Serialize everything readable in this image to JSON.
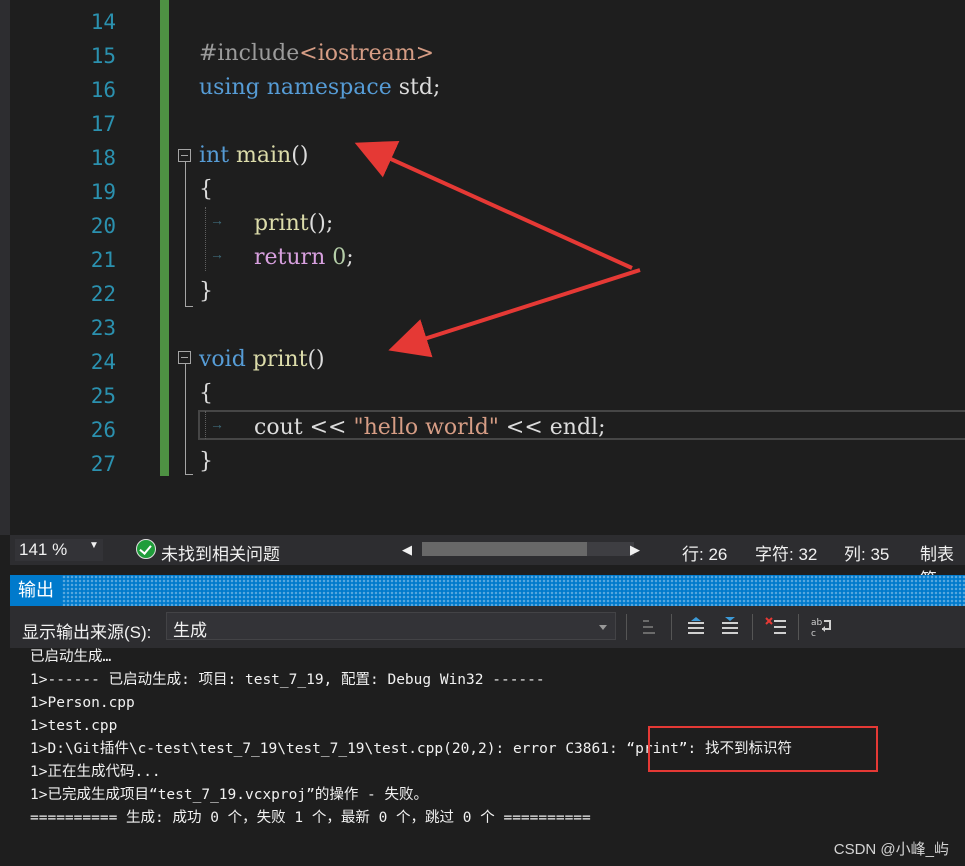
{
  "editor": {
    "line_numbers": [
      "14",
      "15",
      "16",
      "17",
      "18",
      "19",
      "20",
      "21",
      "22",
      "23",
      "24",
      "25",
      "26",
      "27"
    ],
    "lines": {
      "l15_pre": "#include",
      "l15_inc": "<iostream>",
      "l16_kw1": "using",
      "l16_kw2": "namespace",
      "l16_ns": "std",
      "l16_end": ";",
      "l18_kw": "int",
      "l18_fn": "main",
      "l18_end": "()",
      "l19": "{",
      "l20_fn": "print",
      "l20_end": "();",
      "l21_ctl": "return",
      "l21_num": "0",
      "l21_end": ";",
      "l22": "}",
      "l24_kw": "void",
      "l24_fn": "print",
      "l24_end": "()",
      "l25": "{",
      "l26_a": "cout",
      "l26_op1": "<<",
      "l26_str": "\"hello world\"",
      "l26_op2": "<<",
      "l26_b": "endl;",
      "l27": "}"
    }
  },
  "statusbar": {
    "zoom": "141 %",
    "issues": "未找到相关问题",
    "line": "行: 26",
    "char": "字符: 32",
    "col": "列: 35",
    "tabs": "制表符"
  },
  "output": {
    "title": "输出",
    "source_label": "显示输出来源(S):",
    "source_value": "生成",
    "lines": [
      "已启动生成…",
      "1>------ 已启动生成: 项目: test_7_19, 配置: Debug Win32 ------",
      "1>Person.cpp",
      "1>test.cpp",
      "1>D:\\Git插件\\c-test\\test_7_19\\test_7_19\\test.cpp(20,2): error C3861: “print”: 找不到标识符",
      "1>正在生成代码...",
      "1>已完成生成项目“test_7_19.vcxproj”的操作 - 失败。",
      "========== 生成: 成功 0 个，失败 1 个，最新 0 个，跳过 0 个 =========="
    ]
  },
  "watermark": "CSDN @小峰_屿",
  "colors": {
    "accent": "#007acc",
    "annotation": "#e53935",
    "green_bar": "#57a64a"
  }
}
